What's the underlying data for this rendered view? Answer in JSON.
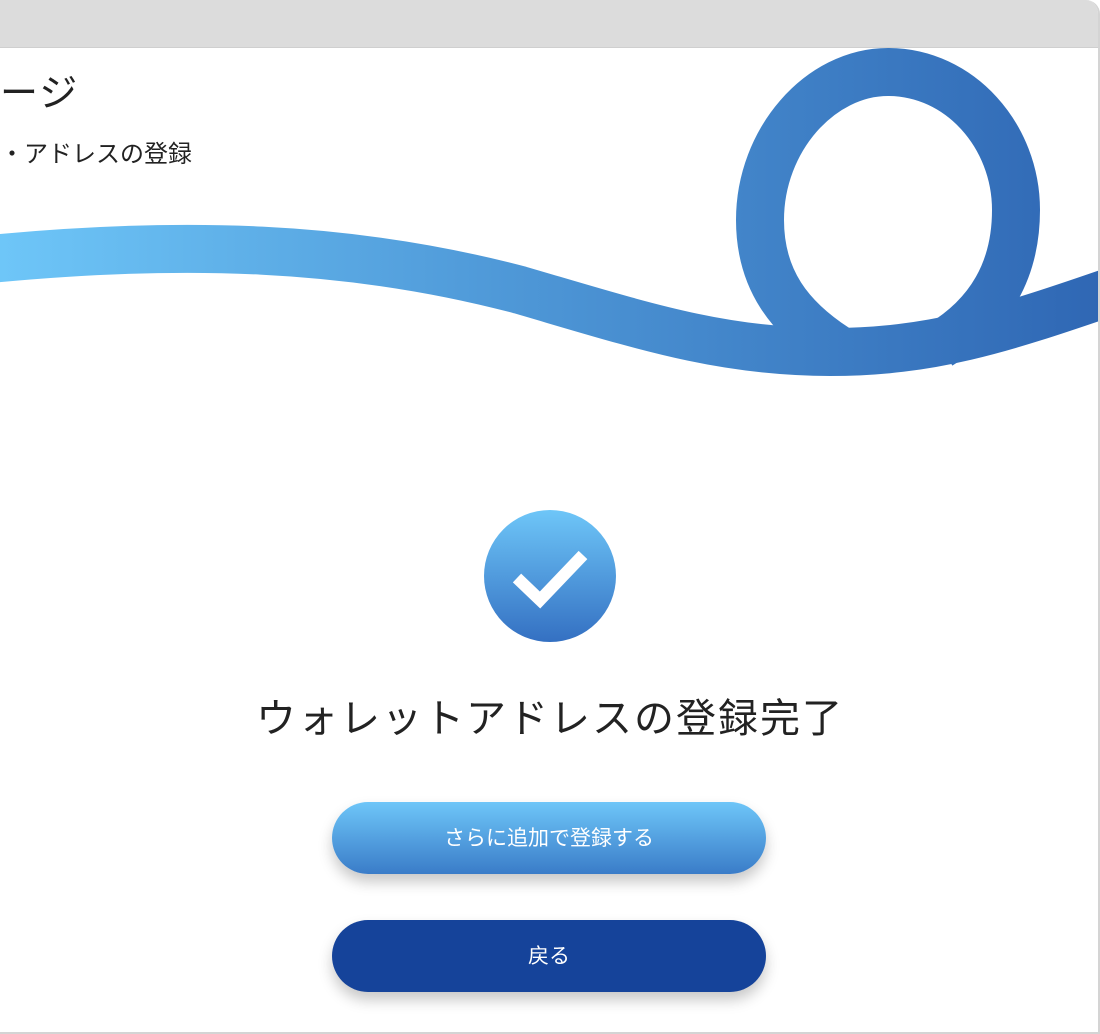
{
  "page": {
    "title": "ージ",
    "subtitle": "・アドレスの登録"
  },
  "result": {
    "icon": "check-circle-icon",
    "heading": "ウォレットアドレスの登録完了"
  },
  "actions": {
    "add_more_label": "さらに追加で登録する",
    "back_label": "戻る"
  },
  "colors": {
    "accent_light": "#6ec6f8",
    "accent_mid": "#3a7cc8",
    "primary_dark": "#15439a",
    "text": "#222222"
  }
}
